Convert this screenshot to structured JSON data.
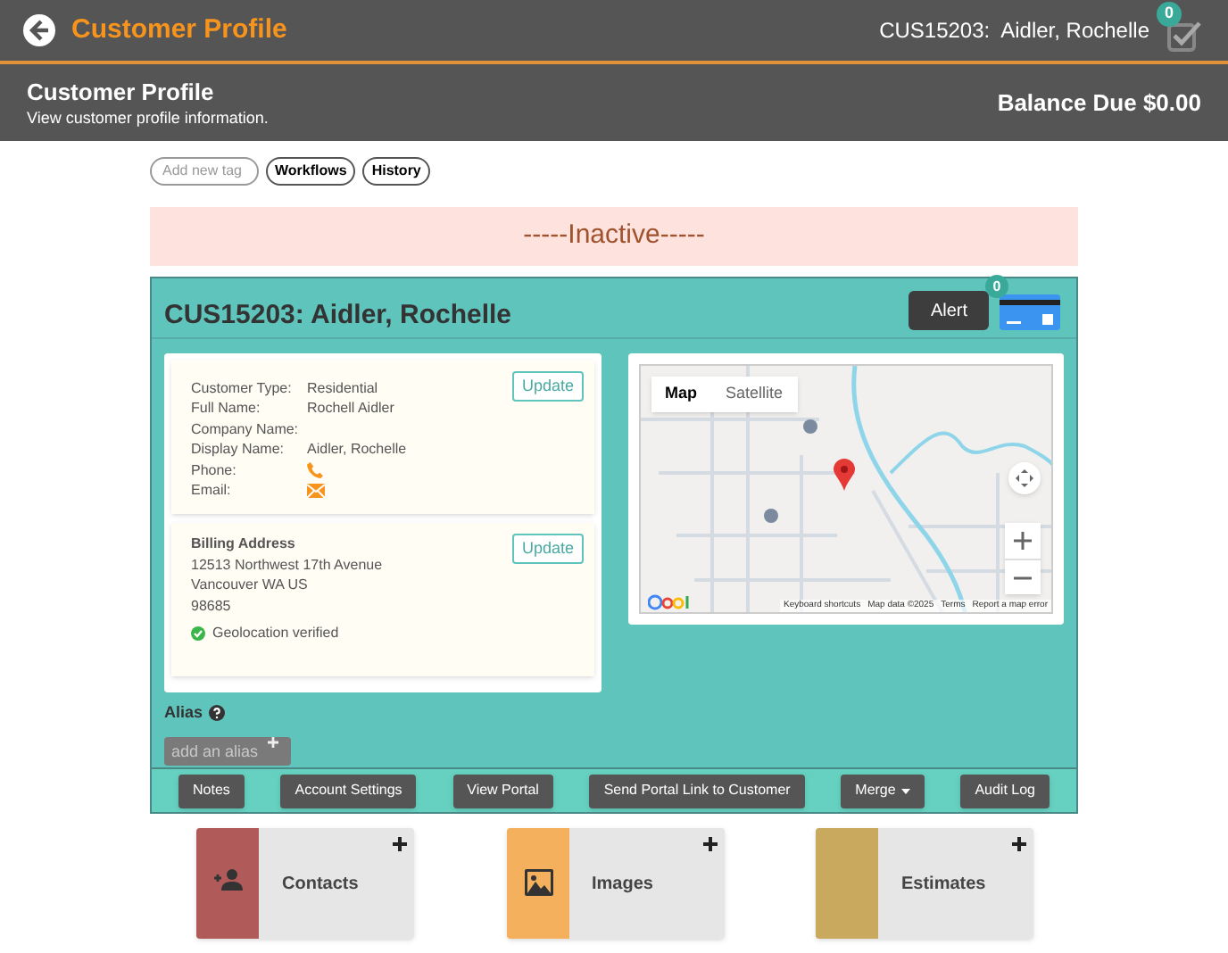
{
  "top_bar": {
    "title": "Customer Profile",
    "customer": "CUS15203:  Aidler, Rochelle",
    "task_count": "0"
  },
  "page_header": {
    "title": "Customer Profile",
    "subtitle": "View customer profile information.",
    "balance": "Balance Due $0.00"
  },
  "tags": {
    "placeholder": "Add new tag",
    "buttons": [
      "Workflows",
      "History"
    ]
  },
  "status_banner": "-----Inactive-----",
  "customer": {
    "title": "CUS15203: Aidler, Rochelle",
    "alert_button": "Alert",
    "card_count": "0"
  },
  "details": {
    "update_button": "Update",
    "fields": [
      {
        "label": "Customer Type:",
        "value": "Residential",
        "kind": "text"
      },
      {
        "label": "Full Name:",
        "value": "Rochell Aidler",
        "kind": "text"
      },
      {
        "label": "Company Name:",
        "kind": "text"
      },
      {
        "label": "Display Name:",
        "value": "Aidler, Rochelle",
        "kind": "text"
      },
      {
        "label": "Phone:",
        "kind": "phone"
      },
      {
        "label": "Email:",
        "kind": "email"
      }
    ]
  },
  "billing": {
    "heading": "Billing Address",
    "lines": [
      "12513 Northwest 17th Avenue",
      "Vancouver WA US",
      "98685"
    ],
    "update_button": "Update",
    "geolocation": "Geolocation verified"
  },
  "map": {
    "tabs": [
      {
        "label": "Map",
        "selected": true
      },
      {
        "label": "Satellite",
        "selected": false
      }
    ],
    "attribution": [
      "Keyboard shortcuts",
      "Map data ©2025",
      "Terms",
      "Report a map error"
    ]
  },
  "alias": {
    "label": "Alias",
    "placeholder": "add an alias"
  },
  "actions": [
    {
      "label": "Notes",
      "kind": "button"
    },
    {
      "label": "Account Settings",
      "kind": "button"
    },
    {
      "label": "View Portal",
      "kind": "button"
    },
    {
      "label": "Send Portal Link to Customer",
      "kind": "button"
    },
    {
      "label": "Merge",
      "kind": "dropdown"
    },
    {
      "label": "Audit Log",
      "kind": "button"
    }
  ],
  "tiles": [
    {
      "label": "Contacts",
      "color": "#b05a5a",
      "kind": "contacts"
    },
    {
      "label": "Images",
      "color": "#f4b05c",
      "kind": "images"
    },
    {
      "label": "Estimates",
      "color": "#c9a95e",
      "kind": "estimates"
    }
  ]
}
